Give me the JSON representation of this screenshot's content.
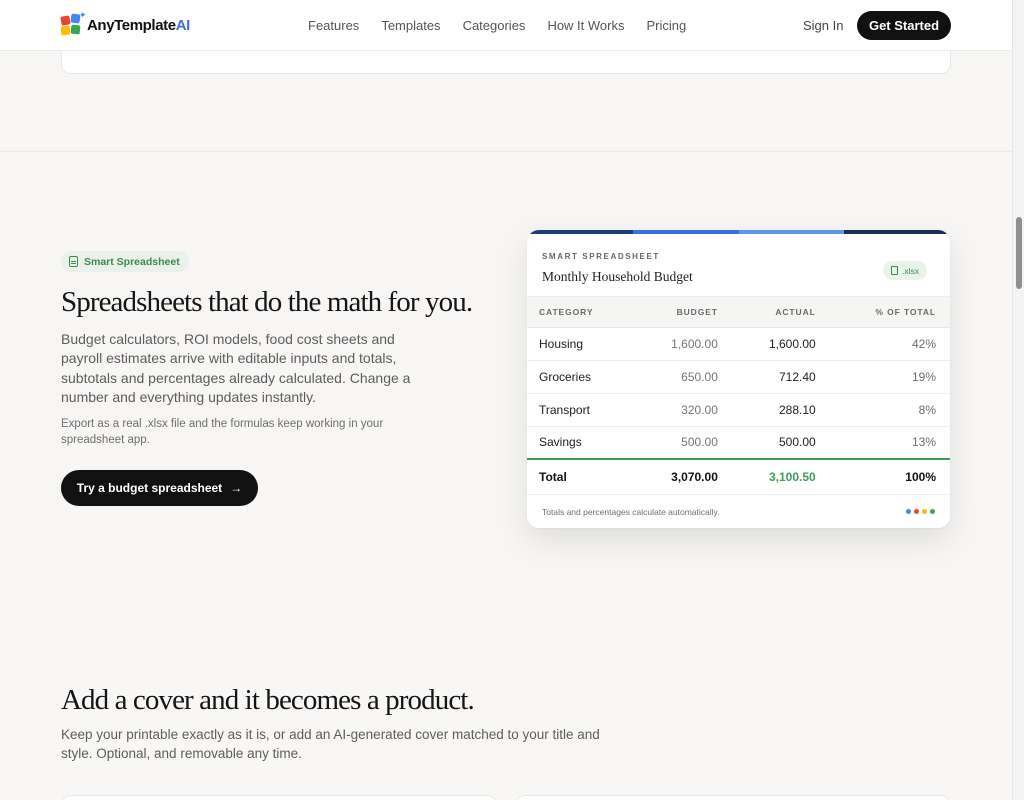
{
  "nav": {
    "brand": "AnyTemplate",
    "brand_ai": "AI",
    "links": [
      "Features",
      "Templates",
      "Categories",
      "How It Works",
      "Pricing"
    ],
    "signin": "Sign In",
    "cta": "Get Started"
  },
  "spreadsheet_section": {
    "badge": "Smart Spreadsheet",
    "heading": "Spreadsheets that do the math for you.",
    "body": "Budget calculators, ROI models, food cost sheets and payroll estimates arrive with editable inputs and totals, subtotals and percentages already calculated. Change a number and everything updates instantly.",
    "note": "Export as a real .xlsx file and the formulas keep working in your spreadsheet app.",
    "button": "Try a budget spreadsheet",
    "button_arrow": "→"
  },
  "sheet": {
    "kicker": "SMART SPREADSHEET",
    "title": "Monthly Household Budget",
    "format_badge": ".xlsx",
    "bar_colors": [
      "#1f3d74",
      "#3b6fe0",
      "#5e97ee",
      "#1b2d52"
    ],
    "columns": [
      "CATEGORY",
      "BUDGET",
      "ACTUAL",
      "% OF TOTAL"
    ],
    "rows": [
      {
        "category": "Housing",
        "budget": "1,600.00",
        "actual": "1,600.00",
        "pct": "42%"
      },
      {
        "category": "Groceries",
        "budget": "650.00",
        "actual": "712.40",
        "pct": "19%"
      },
      {
        "category": "Transport",
        "budget": "320.00",
        "actual": "288.10",
        "pct": "8%"
      },
      {
        "category": "Savings",
        "budget": "500.00",
        "actual": "500.00",
        "pct": "13%"
      }
    ],
    "total": {
      "category": "Total",
      "budget": "3,070.00",
      "actual": "3,100.50",
      "pct": "100%"
    },
    "footer_note": "Totals and percentages calculate automatically.",
    "dot_colors": [
      "#4285f4",
      "#ea4335",
      "#fbbc05",
      "#34a853"
    ]
  },
  "cover_section": {
    "heading": "Add a cover and it becomes a product.",
    "body": "Keep your printable exactly as it is, or add an AI-generated cover matched to your title and style. Optional, and removable any time."
  },
  "colors": {
    "accent_green": "#3f9b56",
    "dark": "#111111",
    "brand_blue": "#3b6fe8"
  }
}
